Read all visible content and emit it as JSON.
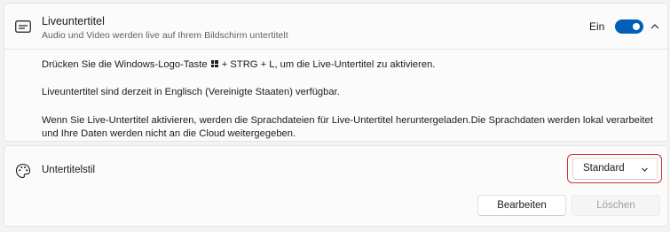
{
  "live_captions": {
    "title": "Liveuntertitel",
    "subtitle": "Audio und Video werden live auf Ihrem Bildschirm untertitelt",
    "toggle_label": "Ein",
    "toggle_on": true,
    "icon": "closed-captions-icon",
    "expand_icon": "chevron-up-icon"
  },
  "details": {
    "shortcut_before": "Drücken Sie die Windows-Logo-Taste",
    "shortcut_after": "+ STRG + L, um die Live-Untertitel zu aktivieren.",
    "availability": "Liveuntertitel sind derzeit in Englisch (Vereinigte Staaten) verfügbar.",
    "privacy": "Wenn Sie Live-Untertitel aktivieren, werden die Sprachdateien für Live-Untertitel heruntergeladen.Die Sprachdaten werden lokal verarbeitet und Ihre Daten werden nicht an die Cloud weitergegeben."
  },
  "caption_style": {
    "label": "Untertitelstil",
    "icon": "palette-icon",
    "selected": "Standard",
    "edit_label": "Bearbeiten",
    "delete_label": "Löschen"
  },
  "colors": {
    "accent": "#005fb8",
    "highlight": "#d13438"
  }
}
